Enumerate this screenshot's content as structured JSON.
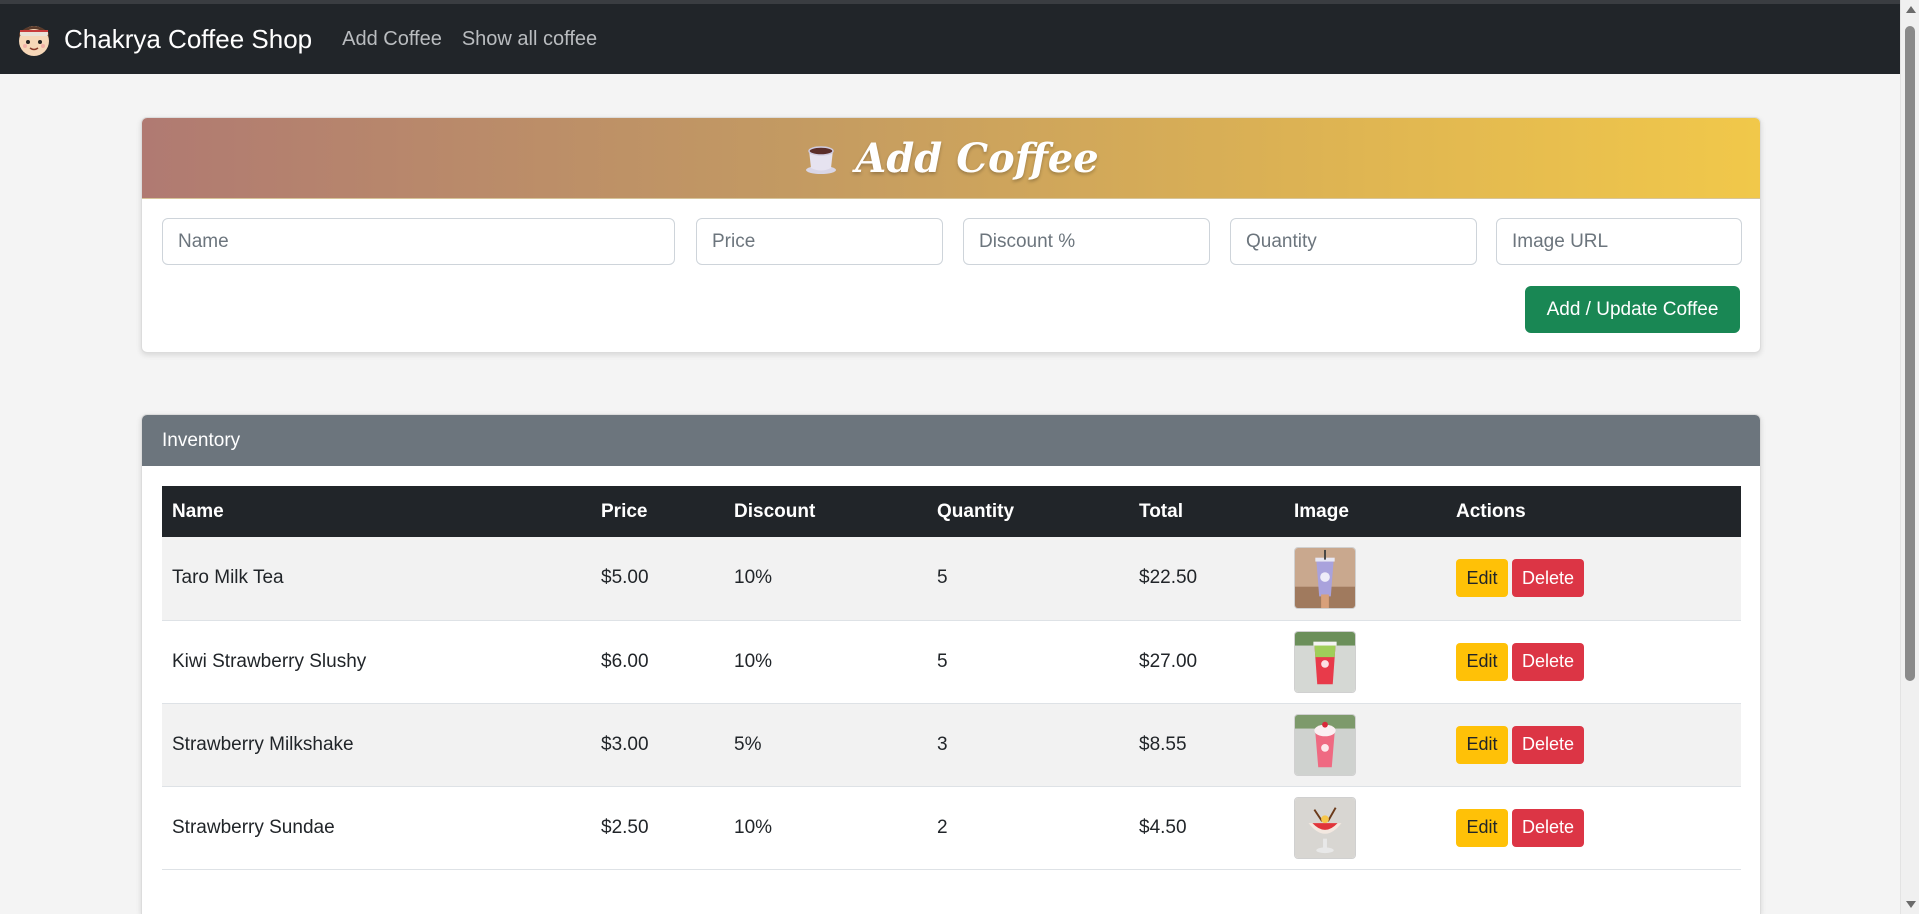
{
  "navbar": {
    "brand": "Chakrya Coffee Shop",
    "links": [
      "Add Coffee",
      "Show all coffee"
    ]
  },
  "add_form": {
    "title": "Add Coffee",
    "placeholders": {
      "name": "Name",
      "price": "Price",
      "discount": "Discount %",
      "quantity": "Quantity",
      "image_url": "Image URL"
    },
    "submit_label": "Add / Update Coffee"
  },
  "inventory": {
    "title": "Inventory",
    "columns": [
      "Name",
      "Price",
      "Discount",
      "Quantity",
      "Total",
      "Image",
      "Actions"
    ],
    "rows": [
      {
        "name": "Taro Milk Tea",
        "price": "$5.00",
        "discount": "10%",
        "quantity": "5",
        "total": "$22.50"
      },
      {
        "name": "Kiwi Strawberry Slushy",
        "price": "$6.00",
        "discount": "10%",
        "quantity": "5",
        "total": "$27.00"
      },
      {
        "name": "Strawberry Milkshake",
        "price": "$3.00",
        "discount": "5%",
        "quantity": "3",
        "total": "$8.55"
      },
      {
        "name": "Strawberry Sundae",
        "price": "$2.50",
        "discount": "10%",
        "quantity": "2",
        "total": "$4.50"
      }
    ],
    "edit_label": "Edit",
    "delete_label": "Delete"
  },
  "colors": {
    "navbar": "#212529",
    "success": "#198754",
    "warning": "#ffc107",
    "danger": "#dc3545",
    "secondary": "#6c757d"
  },
  "icons": {
    "brand": "cartoon-mascot-logo",
    "title": "coffee-cup-icon"
  }
}
